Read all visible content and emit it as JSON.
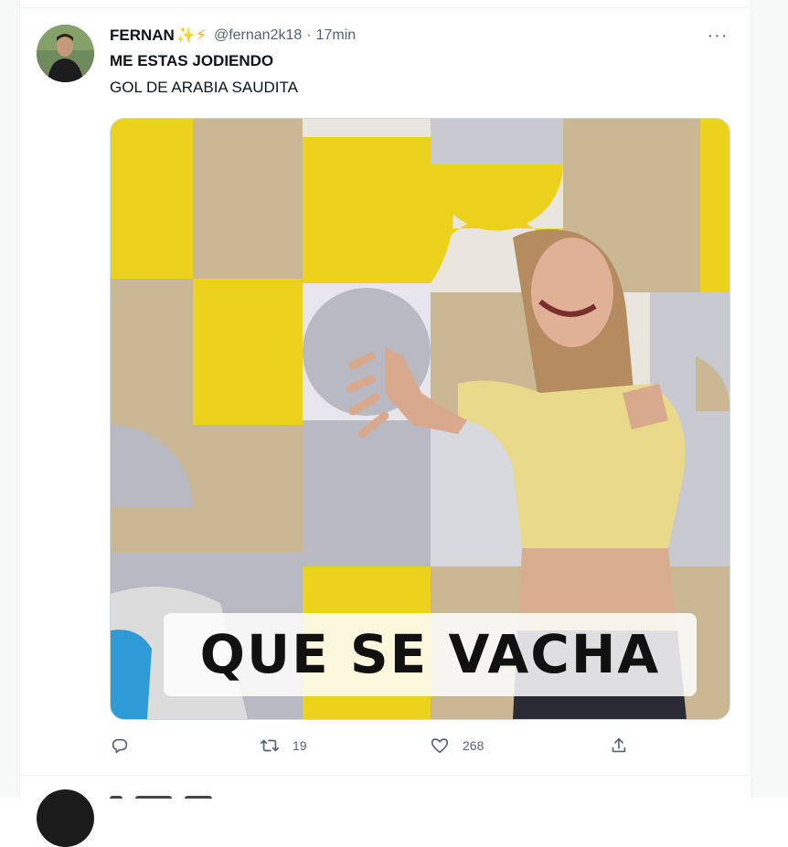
{
  "tweet": {
    "author_name": "FERNAN",
    "author_emojis": "✨⚡",
    "handle": "@fernan2k18",
    "separator": "·",
    "time": "17min",
    "more_icon": "···",
    "text_line1": "ME ESTAS JODIENDO",
    "text_line2": "GOL DE ARABIA SAUDITA",
    "media": {
      "caption": "QUE SE VACHA"
    },
    "actions": {
      "reply_count": "",
      "retweet_count": "19",
      "like_count": "268"
    }
  },
  "icons": {
    "reply": "reply-icon",
    "retweet": "retweet-icon",
    "like": "heart-icon",
    "share": "share-icon",
    "more": "more-icon"
  },
  "colors": {
    "text": "#0f1419",
    "secondary": "#536471",
    "yellow": "#ecd21c",
    "tan": "#c9b893",
    "grey": "#b9b9c3"
  }
}
